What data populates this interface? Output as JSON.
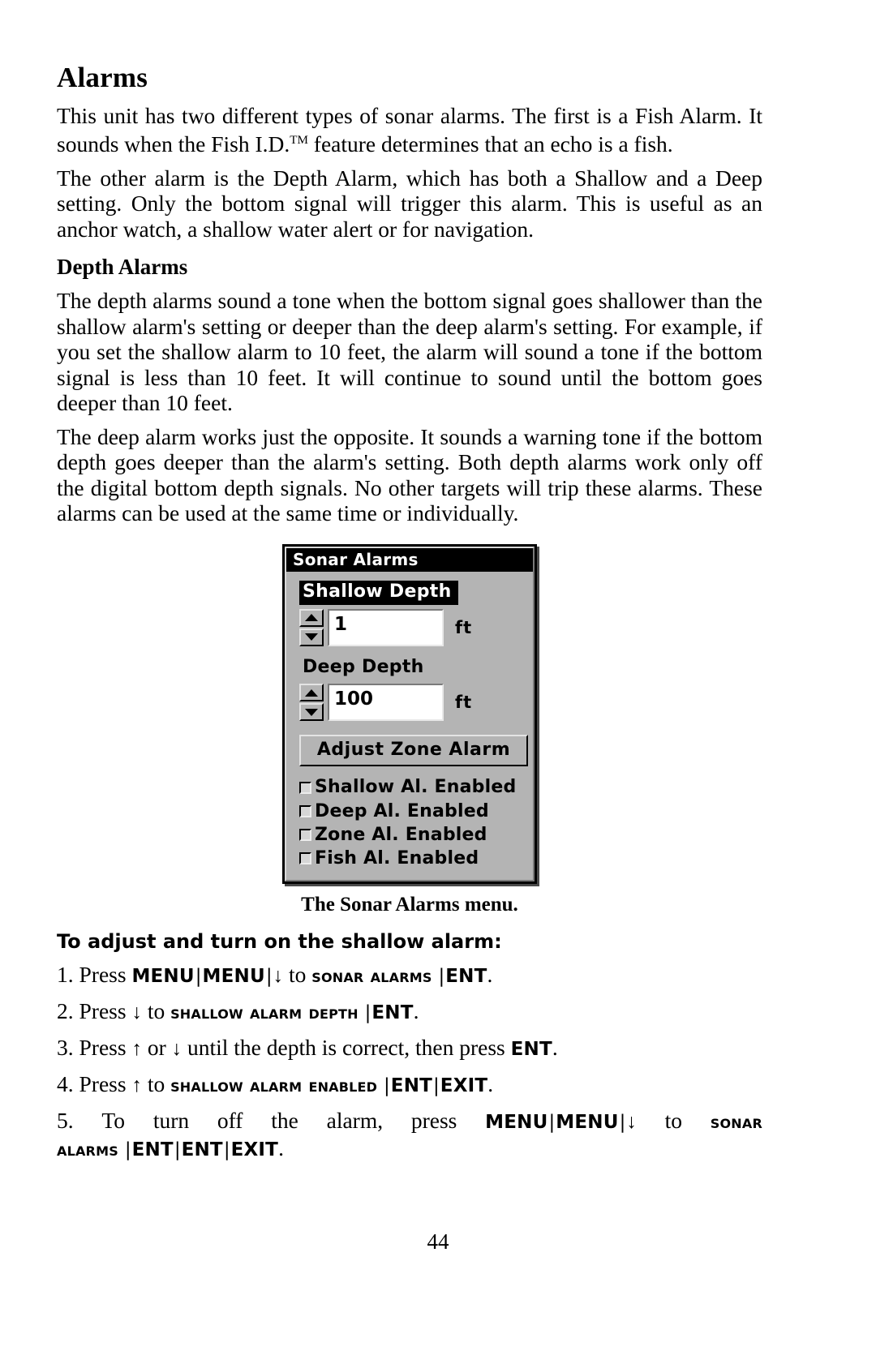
{
  "page": {
    "title": "Alarms",
    "folio": "44"
  },
  "paragraphs": {
    "p1": "This unit has two different types of sonar alarms. The first is a Fish Alarm. It sounds when the Fish I.D.",
    "p1_tm": "TM",
    "p1_rest": " feature determines that an echo is a fish.",
    "p2": "The other alarm is the Depth Alarm, which has both a Shallow and a Deep setting. Only the bottom signal will trigger this alarm. This is useful as an anchor watch, a shallow water alert or for navigation.",
    "subheading": "Depth Alarms",
    "p3": "The depth alarms sound a tone when the bottom signal goes shallower than the shallow alarm's setting or deeper than the deep alarm's setting. For example, if you set the shallow alarm to 10 feet, the alarm will sound a tone if the bottom signal is less than 10 feet. It will continue to sound until the bottom goes deeper than 10 feet.",
    "p4": "The deep alarm works just the opposite. It sounds a warning tone if the bottom depth goes deeper than the alarm's setting. Both depth alarms work only off the digital bottom depth signals. No other targets will trip these alarms. These alarms can be used at the same time or individually."
  },
  "dialog": {
    "titlebar": "Sonar Alarms",
    "shallow": {
      "label": "Shallow Depth",
      "value": "1",
      "unit": "ft",
      "up_icon": "triangle-up-icon",
      "down_icon": "triangle-down-icon"
    },
    "deep": {
      "label": "Deep Depth",
      "value": "100",
      "unit": "ft",
      "up_icon": "triangle-up-icon",
      "down_icon": "triangle-down-icon"
    },
    "zone_button": "Adjust Zone Alarm",
    "checkboxes": [
      {
        "label": "Shallow Al. Enabled",
        "checked": false
      },
      {
        "label": "Deep Al. Enabled",
        "checked": false
      },
      {
        "label": "Zone Al. Enabled",
        "checked": false
      },
      {
        "label": "Fish Al. Enabled",
        "checked": false
      }
    ]
  },
  "figure_caption": "The Sonar Alarms menu.",
  "instructions": {
    "heading": "To adjust and turn on the shallow alarm:",
    "steps": {
      "s1_num": "1.",
      "s1_press": "Press",
      "s1_k1": "MENU",
      "s1_k2": "MENU",
      "s1_arrow": "↓",
      "s1_to": "to",
      "s1_sc": "Sonar Alarms",
      "s1_ent": "ENT",
      "s1_period": ".",
      "s2_num": "2.",
      "s2_press": "Press",
      "s2_arrow": "↓",
      "s2_to": "to",
      "s2_sc": "Shallow Alarm Depth",
      "s2_ent": "ENT",
      "s2_period": ".",
      "s3_num": "3.",
      "s3_text_a": "Press",
      "s3_arrow_up": "↑",
      "s3_or": "or",
      "s3_arrow_down": "↓",
      "s3_text_b": "until the depth is correct, then press",
      "s3_ent": "ENT",
      "s3_period": ".",
      "s4_num": "4.",
      "s4_press": "Press",
      "s4_arrow": "↑",
      "s4_to": "to",
      "s4_sc": "Shallow Alarm Enabled",
      "s4_ent": "ENT",
      "s4_exit": "EXIT",
      "s4_period": ".",
      "s5_num": "5.",
      "s5_text_a": "To turn off the alarm, press",
      "s5_k1": "MENU",
      "s5_k2": "MENU",
      "s5_arrow": "↓",
      "s5_to": "to",
      "s5_sc": "Sonar Alarms",
      "s5_ent1": "ENT",
      "s5_ent2": "ENT",
      "s5_exit": "EXIT",
      "s5_period": "."
    },
    "separator": "|"
  }
}
